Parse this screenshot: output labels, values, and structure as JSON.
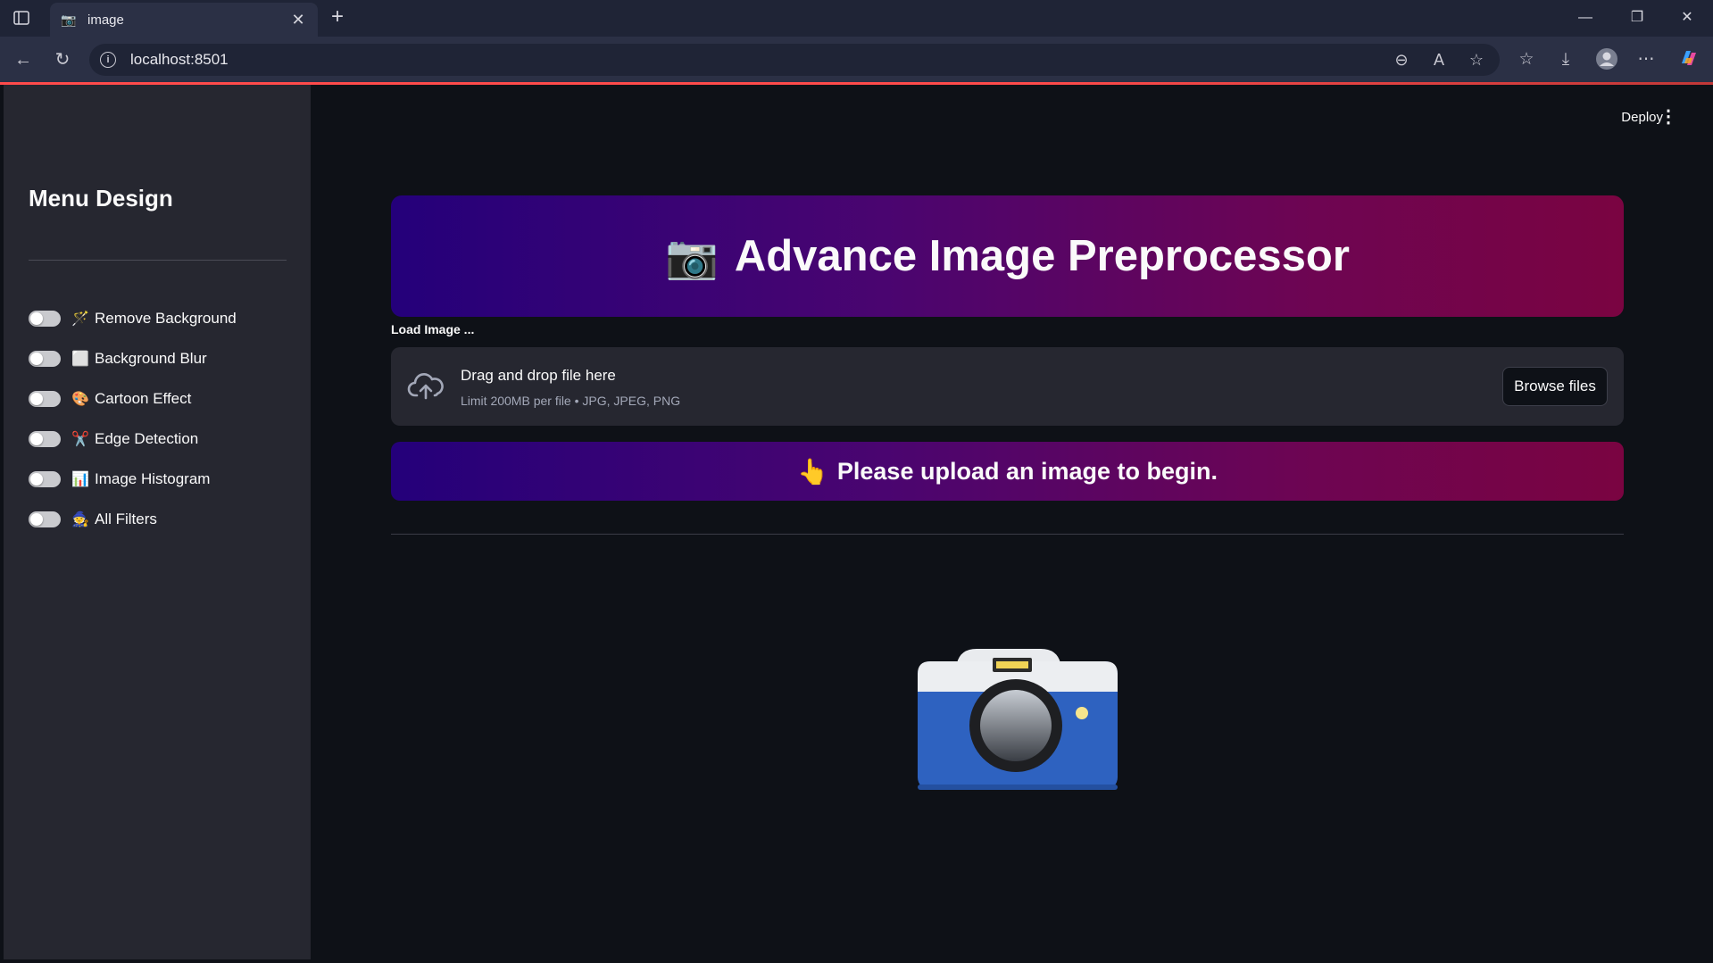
{
  "browser": {
    "tab_title": "image",
    "url": "localhost:8501"
  },
  "app": {
    "deploy_label": "Deploy"
  },
  "sidebar": {
    "title": "Menu Design",
    "items": [
      {
        "label": "Remove Background",
        "emoji": "🪄",
        "enabled": false
      },
      {
        "label": "Background Blur",
        "emoji": "⬜",
        "enabled": false
      },
      {
        "label": "Cartoon Effect",
        "emoji": "🎨",
        "enabled": false
      },
      {
        "label": "Edge Detection",
        "emoji": "✂️",
        "enabled": false
      },
      {
        "label": "Image Histogram",
        "emoji": "📊",
        "enabled": false
      },
      {
        "label": "All Filters",
        "emoji": "🧙",
        "enabled": false
      }
    ]
  },
  "main": {
    "banner": {
      "icon": "📷",
      "title": "Advance Image Preprocessor"
    },
    "load_label": "Load Image ...",
    "uploader": {
      "title": "Drag and drop file here",
      "subtitle": "Limit 200MB per file • JPG, JPEG, PNG",
      "button_label": "Browse files"
    },
    "notice": {
      "icon": "👆",
      "text": "Please upload an image to begin."
    }
  },
  "colors": {
    "app_bg": "#0e1117",
    "sidebar_bg": "#262730",
    "gradient_start": "#24007a",
    "gradient_end": "#7a0441",
    "accent": "#ff4b4b"
  }
}
